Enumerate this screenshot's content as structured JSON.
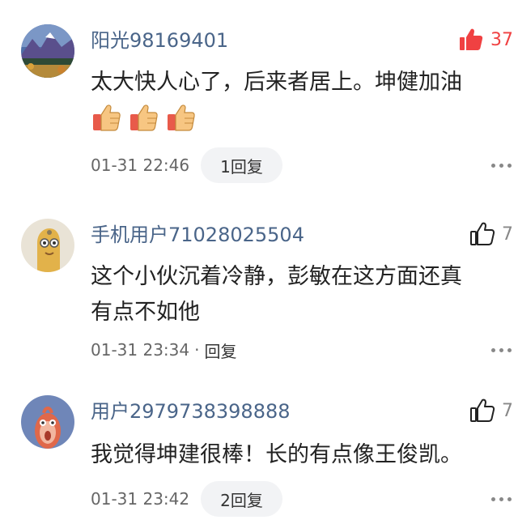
{
  "comments": [
    {
      "username": "阳光98169401",
      "likes": "37",
      "text": "太大快人心了，后来者居上。坤健加油",
      "emojis": [
        "thumbs-up-emoji",
        "thumbs-up-emoji",
        "thumbs-up-emoji"
      ],
      "time": "01-31 22:46",
      "reply": "1回复"
    },
    {
      "username": "手机用户71028025504",
      "likes": "7",
      "text_lines": [
        "这个小伙沉着冷静，彭敏在这方面还真",
        "有点不如他"
      ],
      "time": "01-31 23:34",
      "separator": "·",
      "reply": "回复"
    },
    {
      "username": "用户2979738398888",
      "likes": "7",
      "text": "我觉得坤建很棒！长的有点像王俊凯。",
      "time": "01-31 23:42",
      "reply": "2回复"
    }
  ],
  "colors": {
    "username": "#4a6589",
    "liked": "#f04142",
    "pill_bg": "#f2f3f5"
  },
  "icons": {
    "like_active": "thumbs-up-filled-icon",
    "like": "thumbs-up-outline-icon",
    "more": "more-dots-icon"
  }
}
